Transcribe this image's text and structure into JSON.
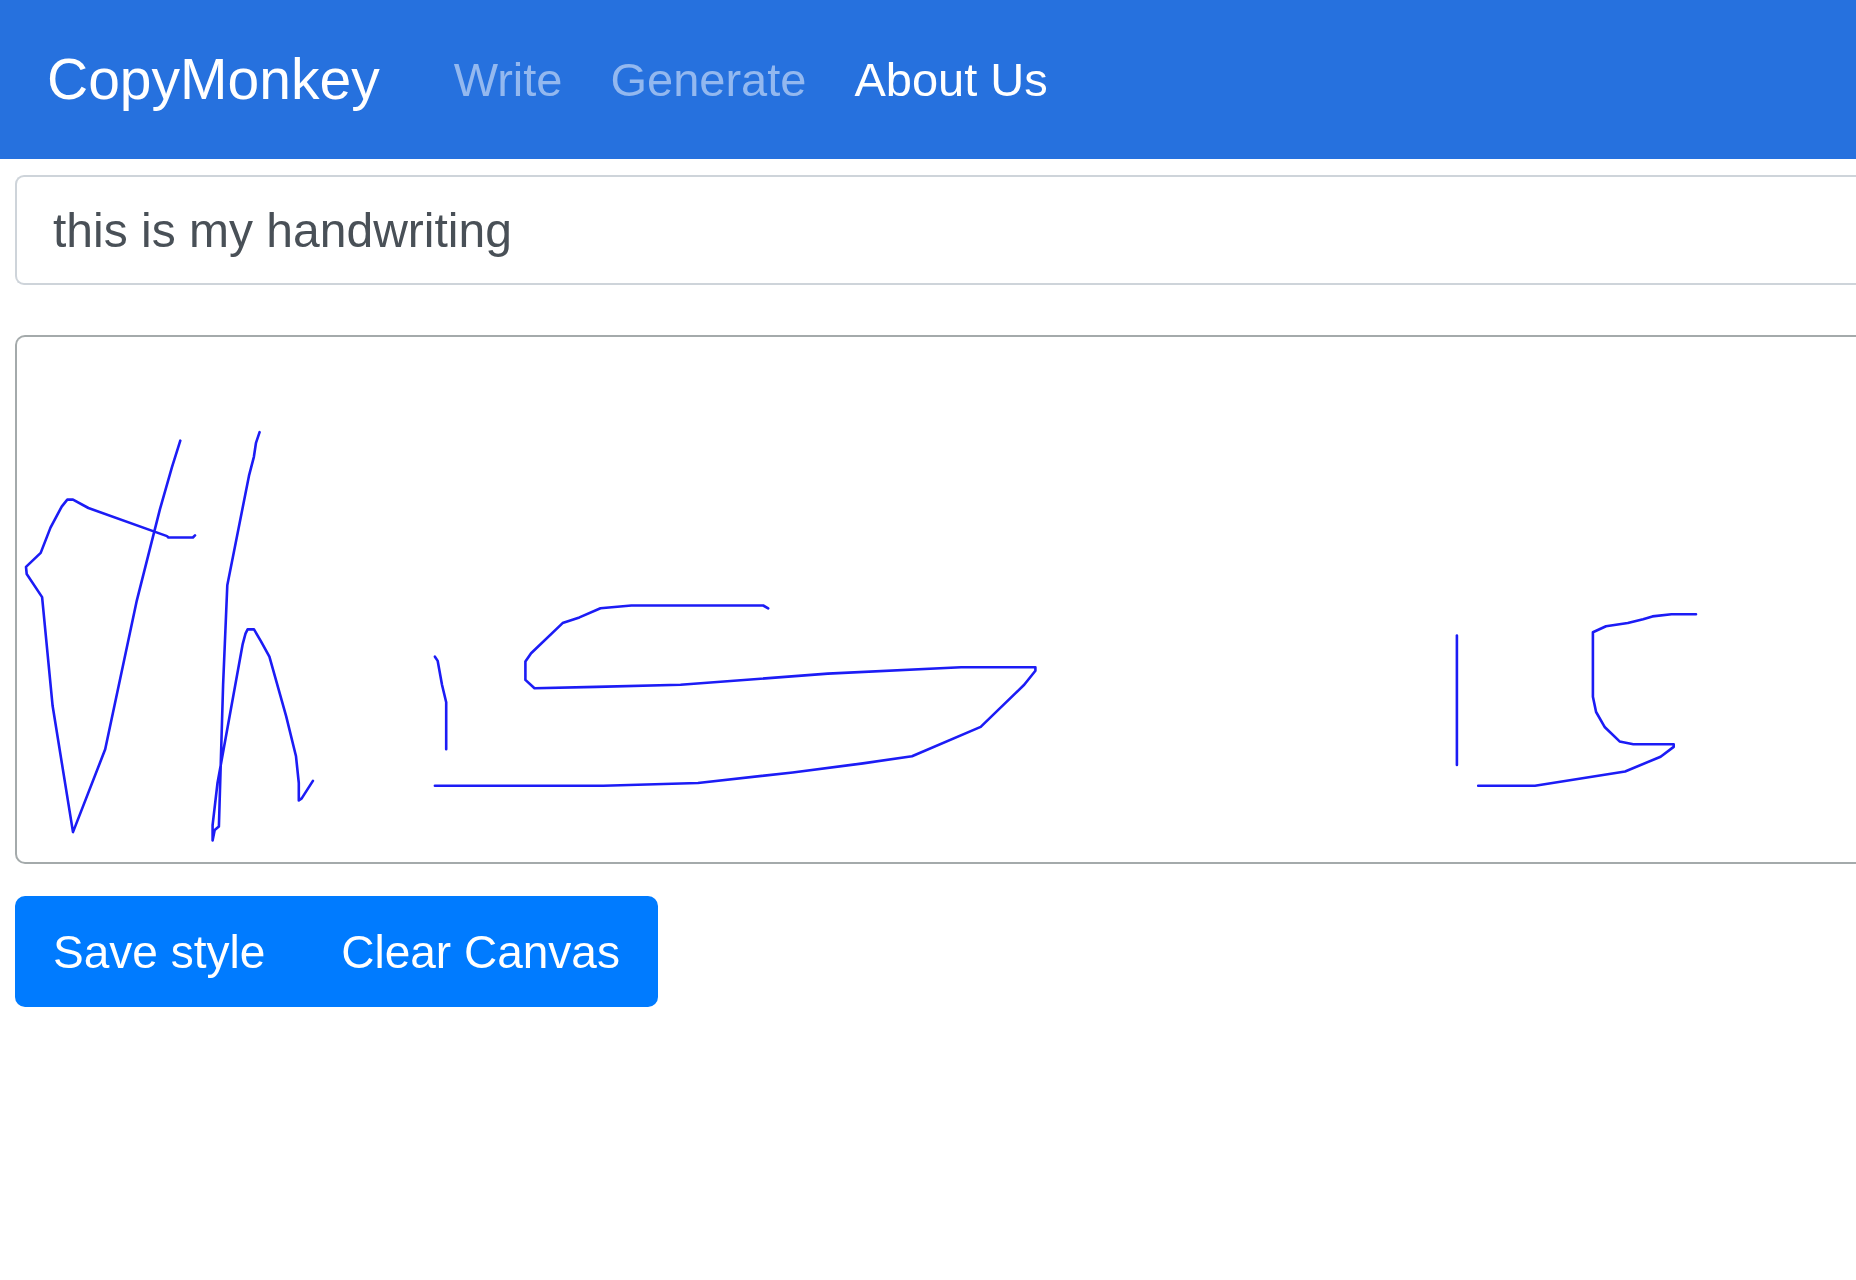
{
  "navbar": {
    "brand": "CopyMonkey",
    "links": [
      {
        "label": "Write",
        "selected": false
      },
      {
        "label": "Generate",
        "selected": false
      },
      {
        "label": "About Us",
        "selected": true
      }
    ]
  },
  "text_input": {
    "value": "this is my handwriting"
  },
  "buttons": [
    {
      "label": "Save style"
    },
    {
      "label": "Clear Canvas"
    }
  ]
}
